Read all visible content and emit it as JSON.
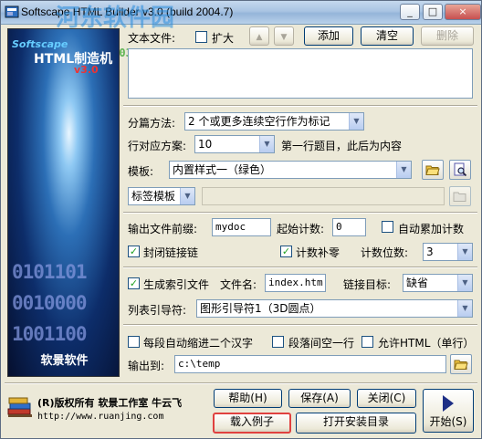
{
  "window": {
    "title": "Softscape HTML Builder v3.0 (build 2004.7)",
    "watermark": "河东软件园",
    "watermark_url": "www.pc0359.cn",
    "controls": {
      "minimize": "_",
      "maximize": "□",
      "close": "×"
    }
  },
  "splash": {
    "logo_top": "Softscape",
    "logo_main": "HTML制造机",
    "version": "v3.0",
    "binary_lines": [
      "0101101",
      "0010000",
      "1001100"
    ],
    "brand": "软景软件"
  },
  "text_file": {
    "label": "文本文件:",
    "expand_label": "扩大",
    "expand_checked": false,
    "up_icon": "▲",
    "down_icon": "▼",
    "add_label": "添加",
    "clear_label": "清空",
    "delete_label": "删除"
  },
  "split": {
    "method_label": "分篇方法:",
    "method_value": "2 个或更多连续空行作为标记",
    "line_label": "行对应方案:",
    "line_value": "10",
    "line_desc": "第一行题目，此后为内容"
  },
  "template": {
    "label": "模板:",
    "value": "内置样式一（绿色）",
    "tag_template": "标签模板"
  },
  "output": {
    "prefix_label": "输出文件前缀:",
    "prefix_value": "mydoc",
    "start_label": "起始计数:",
    "start_value": "0",
    "auto_inc_label": "自动累加计数",
    "auto_inc_checked": false,
    "close_link_label": "封闭链接链",
    "close_link_checked": true,
    "pad_label": "计数补零",
    "pad_checked": true,
    "digits_label": "计数位数:",
    "digits_value": "3"
  },
  "index": {
    "gen_label": "生成索引文件",
    "gen_checked": true,
    "filename_label": "文件名:",
    "filename_value": "index.htm",
    "target_label": "链接目标:",
    "target_value": "缺省",
    "list_label": "列表引导符:",
    "list_value": "图形引导符1（3D圆点）"
  },
  "options": {
    "indent_label": "每段自动缩进二个汉字",
    "indent_checked": false,
    "blank_label": "段落间空一行",
    "blank_checked": false,
    "html_label": "允许HTML（单行）",
    "html_checked": false,
    "dest_label": "输出到:",
    "dest_value": "c:\\temp"
  },
  "footer": {
    "copyright": "(R)版权所有 软景工作室 牛云飞",
    "url": "http://www.ruanjing.com",
    "help_label": "帮助(H)",
    "save_label": "保存(A)",
    "close_label": "关闭(C)",
    "load_example_label": "载入例子",
    "open_dir_label": "打开安装目录",
    "start_label": "开始(S)"
  },
  "colors": {
    "accent": "#003c74",
    "highlight_border": "#e0413f",
    "window_bg": "#ece9d8"
  }
}
